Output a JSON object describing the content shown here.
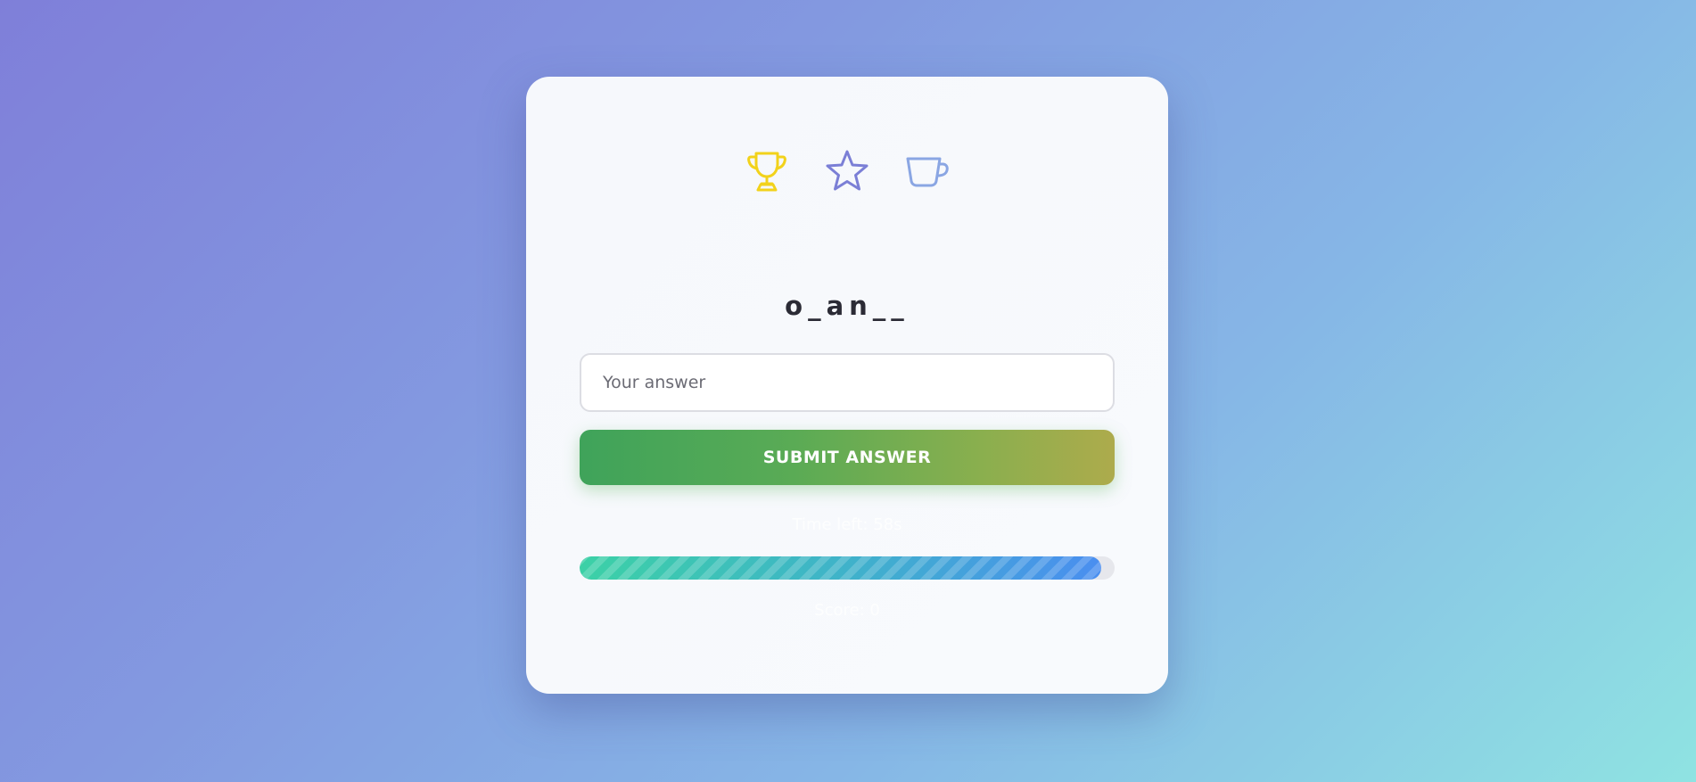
{
  "icons": [
    {
      "name": "trophy-icon",
      "color": "#f2d21b"
    },
    {
      "name": "star-icon",
      "color": "#7b7fd6"
    },
    {
      "name": "cup-icon",
      "color": "#8aa6e3"
    }
  ],
  "puzzle": {
    "word": "o_an__"
  },
  "answer": {
    "placeholder": "Your answer",
    "value": ""
  },
  "submit": {
    "label": "SUBMIT ANSWER"
  },
  "timer": {
    "text": "Time left: 58s"
  },
  "progress": {
    "fraction": 0.975,
    "colors": [
      "#3cd1a6",
      "#4a8ef0"
    ]
  },
  "score": {
    "text": "Score: 0"
  }
}
